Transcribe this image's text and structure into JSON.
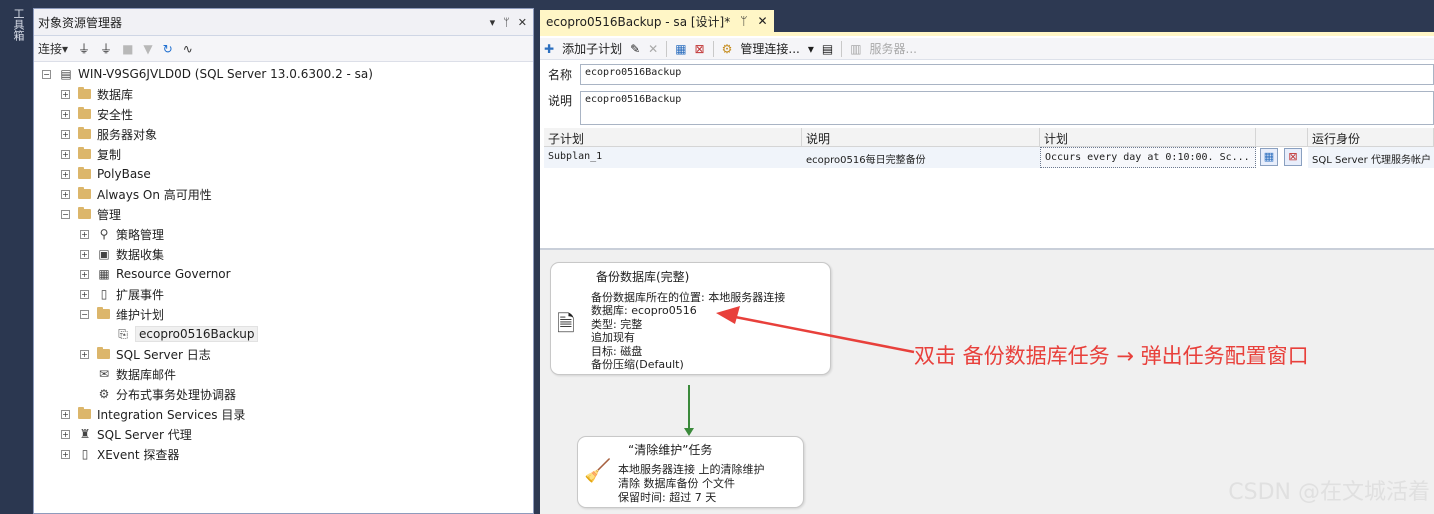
{
  "toolbox": {
    "label": "工具箱"
  },
  "object_explorer": {
    "title": "对象资源管理器",
    "pin_controls": [
      "▾",
      "ᛘ",
      "✕"
    ],
    "toolbar": {
      "connect": "连接▾"
    },
    "tree": [
      {
        "label": "WIN-V9SG6JVLD0D (SQL Server 13.0.6300.2 - sa)",
        "level": 0,
        "expander": "⊟",
        "icon": "server-icon"
      },
      {
        "label": "数据库",
        "level": 1,
        "expander": "⊞",
        "icon": "folder-icon"
      },
      {
        "label": "安全性",
        "level": 1,
        "expander": "⊞",
        "icon": "folder-icon"
      },
      {
        "label": "服务器对象",
        "level": 1,
        "expander": "⊞",
        "icon": "folder-icon"
      },
      {
        "label": "复制",
        "level": 1,
        "expander": "⊞",
        "icon": "folder-icon"
      },
      {
        "label": "PolyBase",
        "level": 1,
        "expander": "⊞",
        "icon": "folder-icon"
      },
      {
        "label": "Always On 高可用性",
        "level": 1,
        "expander": "⊞",
        "icon": "folder-icon"
      },
      {
        "label": "管理",
        "level": 1,
        "expander": "⊟",
        "icon": "folder-icon"
      },
      {
        "label": "策略管理",
        "level": 2,
        "expander": "⊞",
        "icon": "policy-icon"
      },
      {
        "label": "数据收集",
        "level": 2,
        "expander": "⊞",
        "icon": "data-collection-icon"
      },
      {
        "label": "Resource Governor",
        "level": 2,
        "expander": "⊞",
        "icon": "resource-governor-icon"
      },
      {
        "label": "扩展事件",
        "level": 2,
        "expander": "⊞",
        "icon": "extended-events-icon"
      },
      {
        "label": "维护计划",
        "level": 2,
        "expander": "⊟",
        "icon": "folder-icon"
      },
      {
        "label": "ecopro0516Backup",
        "level": 3,
        "expander": "",
        "icon": "maintenance-plan-icon",
        "selected": true
      },
      {
        "label": "SQL Server 日志",
        "level": 2,
        "expander": "⊞",
        "icon": "folder-icon"
      },
      {
        "label": "数据库邮件",
        "level": 2,
        "expander": "",
        "icon": "database-mail-icon"
      },
      {
        "label": "分布式事务处理协调器",
        "level": 2,
        "expander": "",
        "icon": "dtc-icon"
      },
      {
        "label": "Integration Services 目录",
        "level": 1,
        "expander": "⊞",
        "icon": "folder-icon"
      },
      {
        "label": "SQL Server 代理",
        "level": 1,
        "expander": "⊞",
        "icon": "sql-agent-icon"
      },
      {
        "label": "XEvent 探查器",
        "level": 1,
        "expander": "⊞",
        "icon": "xevent-icon"
      }
    ]
  },
  "document": {
    "tab": {
      "title": "ecopro0516Backup - sa [设计]*",
      "pin": "ᛘ",
      "close": "✕"
    },
    "toolbar": {
      "add_subplan": "添加子计划",
      "manage_connections": "管理连接...",
      "servers": "服务器..."
    },
    "name_label": "名称",
    "name_value": "ecopro0516Backup",
    "desc_label": "说明",
    "desc_value": "ecopro0516Backup",
    "grid": {
      "headers": [
        "子计划",
        "说明",
        "计划",
        "",
        "运行身份"
      ],
      "row": {
        "subplan": "Subplan_1",
        "description": "ecopro0516每日完整备份",
        "schedule": "Occurs every day at 0:10:00. Sc...",
        "run_as": "SQL Server 代理服务帐户"
      }
    },
    "tasks": {
      "backup": {
        "title": "备份数据库(完整)",
        "lines": [
          "备份数据库所在的位置: 本地服务器连接",
          "数据库: ecopro0516",
          "类型: 完整",
          "追加现有",
          "目标: 磁盘",
          "备份压缩(Default)"
        ]
      },
      "cleanup": {
        "title": "“清除维护”任务",
        "lines": [
          "本地服务器连接 上的清除维护",
          "清除 数据库备份 个文件",
          "保留时间: 超过 7 天"
        ]
      }
    },
    "annotation": "双击 备份数据库任务 → 弹出任务配置窗口"
  },
  "watermark": "CSDN @在文城活着",
  "colors": {
    "chrome": "#2d3952",
    "active_tab": "#fff6c6",
    "annotation": "#e8403b",
    "connector": "#3b8a3b"
  }
}
